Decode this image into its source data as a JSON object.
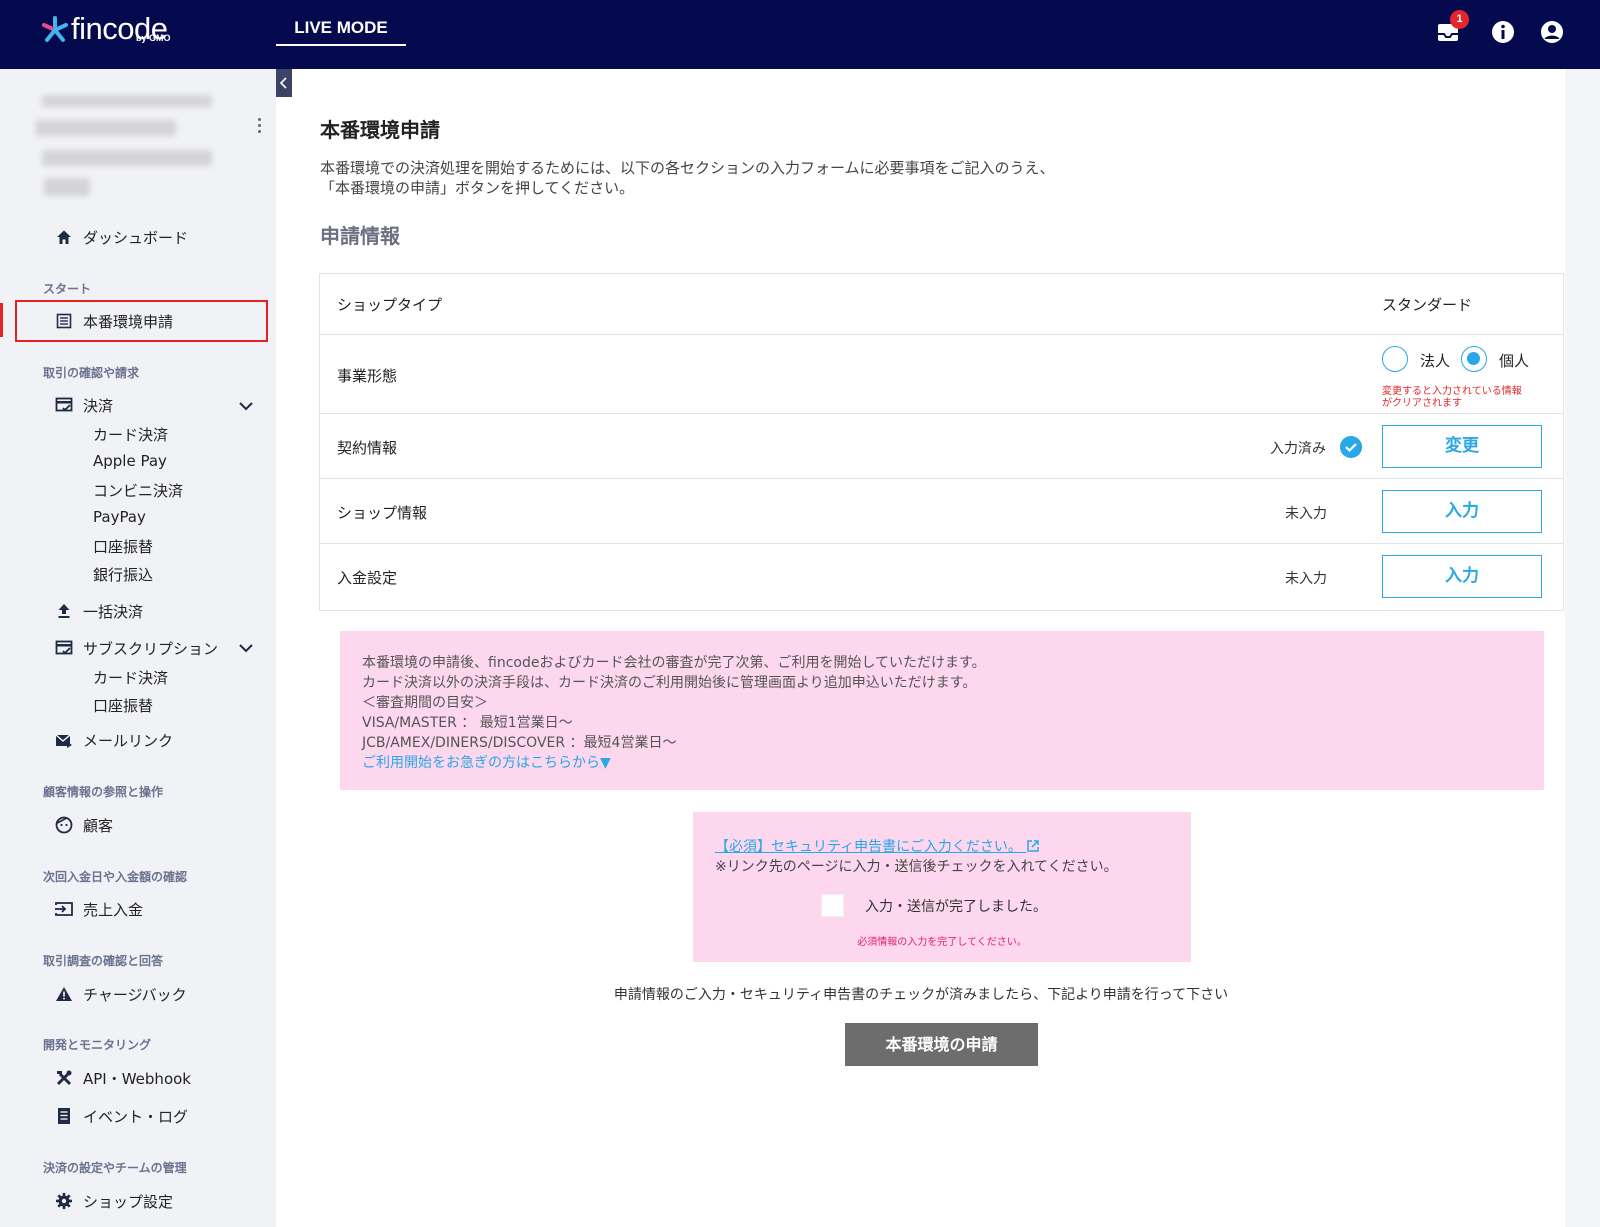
{
  "header": {
    "logo_text": "fincode",
    "logo_sub": "by GMO",
    "mode_tab": "LIVE MODE",
    "notification_count": "1",
    "icons": [
      "inbox-icon",
      "info-icon",
      "account-icon"
    ]
  },
  "sidebar": {
    "sections": {
      "start": "スタート",
      "transactions": "取引の確認や請求",
      "customers": "顧客情報の参照と操作",
      "deposits": "次回入金日や入金額の確認",
      "disputes": "取引調査の確認と回答",
      "dev": "開発とモニタリング",
      "settings": "決済の設定やチームの管理"
    },
    "items": {
      "dashboard": "ダッシュボード",
      "live_application": "本番環境申請",
      "payments": "決済",
      "card": "カード決済",
      "applepay": "Apple Pay",
      "konbini": "コンビニ決済",
      "paypay": "PayPay",
      "direct_debit": "口座振替",
      "bank_transfer": "銀行振込",
      "bulk": "一括決済",
      "subscription": "サブスクリプション",
      "sub_card": "カード決済",
      "sub_direct_debit": "口座振替",
      "maillink": "メールリンク",
      "customer": "顧客",
      "sales_deposit": "売上入金",
      "chargeback": "チャージバック",
      "api_webhook": "API・Webhook",
      "event_log": "イベント・ログ",
      "shop_settings": "ショップ設定"
    }
  },
  "main": {
    "title": "本番環境申請",
    "desc_line1": "本番環境での決済処理を開始するためには、以下の各セクションの入力フォームに必要事項をご記入のうえ、",
    "desc_line2": "「本番環境の申請」ボタンを押してください。",
    "section_title": "申請情報",
    "rows": {
      "shop_type": {
        "label": "ショップタイプ",
        "value": "スタンダード"
      },
      "business_form": {
        "label": "事業形態",
        "option_corp": "法人",
        "option_individual": "個人",
        "selected": "個人",
        "warning_line1": "変更すると入力されている情報",
        "warning_line2": "がクリアされます"
      },
      "contract": {
        "label": "契約情報",
        "status": "入力済み",
        "button": "変更"
      },
      "shop_info": {
        "label": "ショップ情報",
        "status": "未入力",
        "button": "入力"
      },
      "deposit_settings": {
        "label": "入金設定",
        "status": "未入力",
        "button": "入力"
      }
    },
    "info_box": {
      "line1": "本番環境の申請後、fincodeおよびカード会社の審査が完了次第、ご利用を開始していただけます。",
      "line2": "カード決済以外の決済手段は、カード決済のご利用開始後に管理画面より追加申込いただけます。",
      "line3": "＜審査期間の目安＞",
      "line4": "VISA/MASTER ： 最短1営業日〜",
      "line5": "JCB/AMEX/DINERS/DISCOVER ：最短4営業日〜",
      "link": "ご利用開始をお急ぎの方はこちらから▼"
    },
    "security_box": {
      "link": "【必須】セキュリティ申告書にご入力ください。",
      "note": "※リンク先のページに入力・送信後チェックを入れてください。",
      "checkbox_label": "入力・送信が完了しました。",
      "checked": false,
      "error": "必須情報の入力を完了してください。"
    },
    "footer_note": "申請情報のご入力・セキュリティ申告書のチェックが済みましたら、下記より申請を行って下さい",
    "submit_button": "本番環境の申請"
  },
  "colors": {
    "header_bg": "#050a4e",
    "accent": "#2aa7e6",
    "info_bg": "#fdd7ee",
    "highlight": "#e52222",
    "submit_bg": "#6d6d6d"
  }
}
